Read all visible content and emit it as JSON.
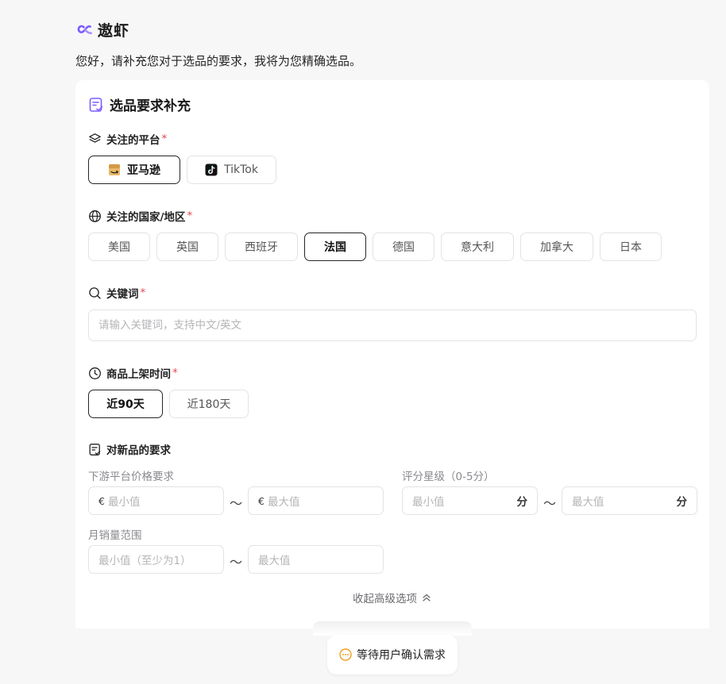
{
  "brand": {
    "name": "遨虾",
    "accent": "#7c5cff"
  },
  "greeting": "您好，请补充您对于选品的要求，我将为您精确选品。",
  "card": {
    "title": "选品要求补充",
    "platform": {
      "label": "关注的平台",
      "required_mark": "*",
      "options": [
        {
          "label": "亚马逊",
          "icon": "amazon-box-icon",
          "selected": true
        },
        {
          "label": "TikTok",
          "icon": "tiktok-icon",
          "selected": false
        }
      ]
    },
    "country": {
      "label": "关注的国家/地区",
      "required_mark": "*",
      "options": [
        {
          "label": "美国",
          "selected": false
        },
        {
          "label": "英国",
          "selected": false
        },
        {
          "label": "西班牙",
          "selected": false
        },
        {
          "label": "法国",
          "selected": true
        },
        {
          "label": "德国",
          "selected": false
        },
        {
          "label": "意大利",
          "selected": false
        },
        {
          "label": "加拿大",
          "selected": false
        },
        {
          "label": "日本",
          "selected": false
        }
      ]
    },
    "keyword": {
      "label": "关键词",
      "required_mark": "*",
      "placeholder": "请输入关键词，支持中文/英文",
      "value": ""
    },
    "listing_time": {
      "label": "商品上架时间",
      "required_mark": "*",
      "options": [
        {
          "label": "近90天",
          "selected": true
        },
        {
          "label": "近180天",
          "selected": false
        }
      ]
    },
    "new_product": {
      "label": "对新品的要求",
      "price": {
        "label": "下游平台价格要求",
        "currency": "€",
        "min_placeholder": "最小值",
        "max_placeholder": "最大值"
      },
      "rating": {
        "label": "评分星级（0-5分）",
        "min_placeholder": "最小值",
        "max_placeholder": "最大值",
        "unit": "分"
      },
      "monthly_sales": {
        "label": "月销量范围",
        "min_placeholder": "最小值（至少为1）",
        "max_placeholder": "最大值"
      },
      "range_separator": "～"
    },
    "collapse_label": "收起高级选项"
  },
  "status": {
    "label": "等待用户确认需求",
    "icon": "pending-dots-icon"
  }
}
